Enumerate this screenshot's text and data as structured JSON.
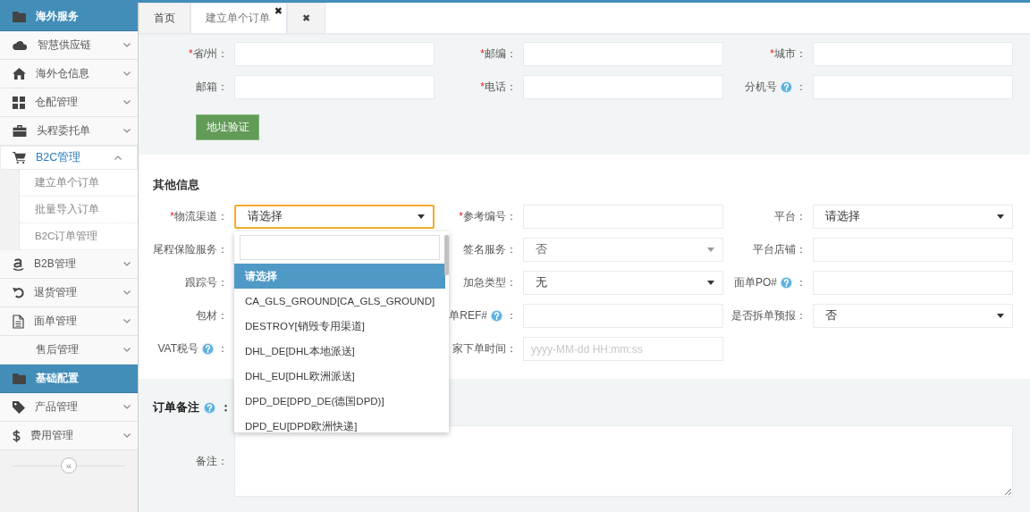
{
  "sidebar": {
    "items": [
      {
        "kind": "header",
        "label": "海外服务"
      },
      {
        "kind": "item",
        "label": "智慧供应链",
        "expanded": false,
        "selected": false
      },
      {
        "kind": "item",
        "label": "海外仓信息",
        "expanded": false,
        "selected": false
      },
      {
        "kind": "item",
        "label": "仓配管理",
        "expanded": false,
        "selected": false
      },
      {
        "kind": "item",
        "label": "头程委托单",
        "expanded": false,
        "selected": false
      },
      {
        "kind": "item",
        "label": "B2C管理",
        "expanded": true,
        "selected": true,
        "children": [
          {
            "label": "建立单个订单"
          },
          {
            "label": "批量导入订单"
          },
          {
            "label": "B2C订单管理"
          }
        ]
      },
      {
        "kind": "item",
        "label": "B2B管理",
        "expanded": false,
        "selected": false
      },
      {
        "kind": "item",
        "label": "退货管理",
        "expanded": false,
        "selected": false
      },
      {
        "kind": "item",
        "label": "面单管理",
        "expanded": false,
        "selected": false
      },
      {
        "kind": "item",
        "label": "售后管理",
        "expanded": false,
        "selected": false
      },
      {
        "kind": "header",
        "label": "基础配置"
      },
      {
        "kind": "item",
        "label": "产品管理",
        "expanded": false,
        "selected": false
      },
      {
        "kind": "item",
        "label": "费用管理",
        "expanded": false,
        "selected": false
      }
    ],
    "collapse_button": "«"
  },
  "tabs": [
    {
      "kind": "tab",
      "label": "首页",
      "selected": false
    },
    {
      "kind": "tab",
      "label": "建立单个订单",
      "selected": true,
      "close": "✖"
    },
    {
      "kind": "close-all",
      "label": "✖",
      "selected": false
    }
  ],
  "address": {
    "fields": [
      {
        "mark": "*",
        "label": "省/州：",
        "kind": "text"
      },
      {
        "mark": "*",
        "label": "邮编：",
        "kind": "text"
      },
      {
        "mark": "*",
        "label": "城市：",
        "kind": "text"
      },
      {
        "label": "邮箱：",
        "kind": "text"
      },
      {
        "mark": "*",
        "label": "电话：",
        "kind": "text"
      },
      {
        "label": "分机号",
        "help": true,
        "colon": "：",
        "kind": "text"
      }
    ],
    "verify_button": "地址验证"
  },
  "other": {
    "title": "其他信息",
    "fields": [
      {
        "mark": "*",
        "label": "物流渠道：",
        "kind": "select",
        "value": "请选择",
        "focused": true
      },
      {
        "mark": "*",
        "label": "参考编号：",
        "kind": "text"
      },
      {
        "label": "平台：",
        "kind": "select",
        "value": "请选择"
      },
      {
        "label": "尾程保险服务："
      },
      {
        "label": "签名服务：",
        "kind": "select",
        "value": "否",
        "disabled": true
      },
      {
        "label": "平台店铺：",
        "kind": "text"
      },
      {
        "label": "跟踪号："
      },
      {
        "label": "加急类型：",
        "kind": "select",
        "value": "无"
      },
      {
        "label": "面单PO#",
        "help": true,
        "colon": "：",
        "kind": "text"
      },
      {
        "label": "包材："
      },
      {
        "label": "单REF#",
        "help": true,
        "colon": "：",
        "kind": "text"
      },
      {
        "label": "是否拆单预报：",
        "kind": "select",
        "value": "否"
      },
      {
        "label": "VAT税号",
        "help": true,
        "colon": "："
      },
      {
        "label": "家下单时间：",
        "kind": "date",
        "placeholder": "yyyy-MM-dd HH:mm:ss"
      }
    ],
    "dropdown": {
      "options": [
        {
          "label": "请选择",
          "selected": true
        },
        {
          "label": "CA_GLS_GROUND[CA_GLS_GROUND]",
          "selected": false
        },
        {
          "label": "DESTROY[销毁专用渠道]",
          "selected": false
        },
        {
          "label": "DHL_DE[DHL本地派送]",
          "selected": false
        },
        {
          "label": "DHL_EU[DHL欧洲派送]",
          "selected": false
        },
        {
          "label": "DPD_DE[DPD_DE(德国DPD)]",
          "selected": false
        },
        {
          "label": "DPD_EU[DPD欧洲快递]",
          "selected": false
        }
      ]
    }
  },
  "remarks": {
    "title": "订单备注",
    "help": true,
    "colon": "：",
    "label": "备注："
  }
}
